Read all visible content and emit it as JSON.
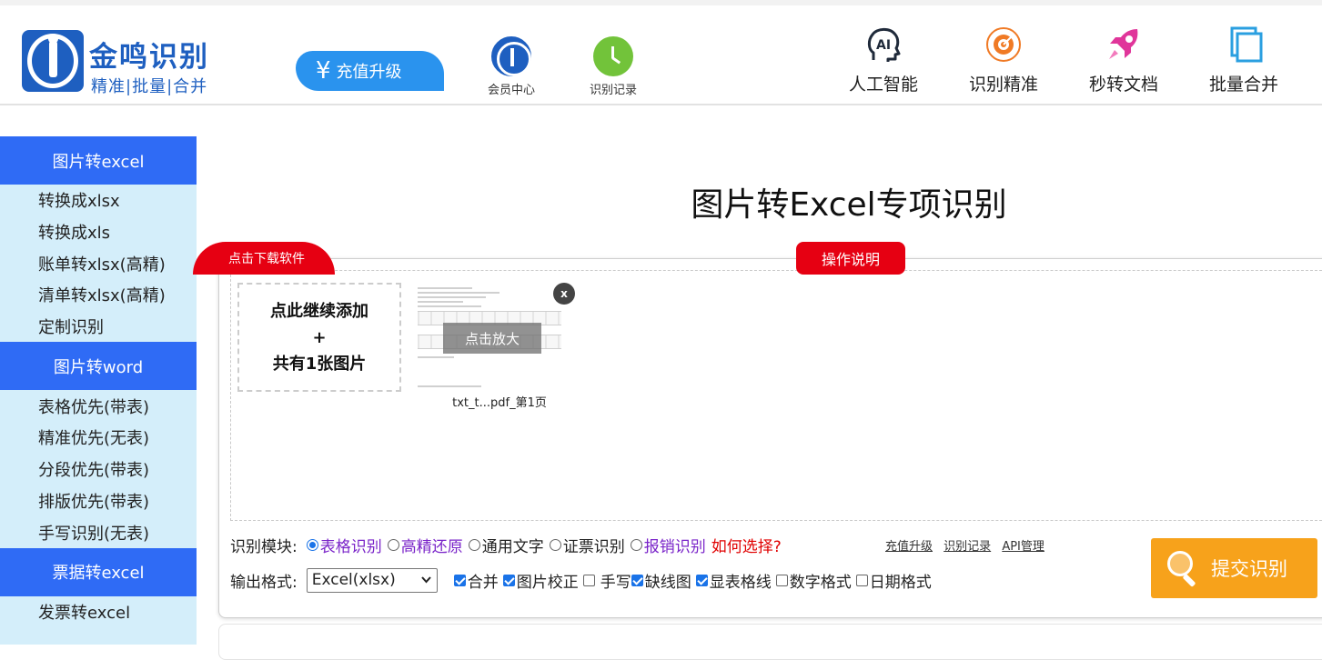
{
  "header": {
    "logo_name": "金鸣识别",
    "logo_tagline": "精准|批量|合并",
    "recharge_label": "充值升级",
    "recharge_symbol": "¥",
    "member_label": "会员中心",
    "record_label": "识别记录",
    "features": [
      "人工智能",
      "识别精准",
      "秒转文档",
      "批量合并"
    ],
    "ai_icon_text": "AI"
  },
  "sidebar": {
    "groups": [
      {
        "title": "图片转excel",
        "items": [
          "转换成xlsx",
          "转换成xls",
          "账单转xlsx(高精)",
          "清单转xlsx(高精)",
          "定制识别"
        ]
      },
      {
        "title": "图片转word",
        "items": [
          "表格优先(带表)",
          "精准优先(无表)",
          "分段优先(带表)",
          "排版优先(带表)",
          "手写识别(无表)"
        ]
      },
      {
        "title": "票据转excel",
        "items": [
          "发票转excel"
        ]
      }
    ]
  },
  "main": {
    "title": "图片转Excel专项识别",
    "download_tab": "点击下载软件",
    "help_tab": "操作说明",
    "add_box": {
      "line1": "点此继续添加",
      "line2": "+",
      "line3": "共有1张图片"
    },
    "thumbnail": {
      "zoom_label": "点击放大",
      "close_label": "x",
      "filename": "txt_t...pdf_第1页"
    },
    "module": {
      "label": "识别模块:",
      "options": [
        "表格识别",
        "高精还原",
        "通用文字",
        "证票识别",
        "报销识别"
      ],
      "selected": "表格识别",
      "how_choose": "如何选择?"
    },
    "links": [
      "充值升级",
      "识别记录",
      "API管理"
    ],
    "output": {
      "label": "输出格式:",
      "format_value": "Excel(xlsx)",
      "checks": [
        {
          "label": "合并",
          "checked": true
        },
        {
          "label": "图片校正",
          "checked": true
        },
        {
          "label": "手写",
          "checked": false
        },
        {
          "label": "缺线图",
          "checked": true
        },
        {
          "label": "显表格线",
          "checked": true
        },
        {
          "label": "数字格式",
          "checked": false
        },
        {
          "label": "日期格式",
          "checked": false
        }
      ]
    },
    "submit_label": "提交识别"
  },
  "colors": {
    "brand_blue": "#1e5fc0",
    "sidebar_head": "#2f6bf5",
    "sidebar_bg": "#d4eefa",
    "accent_red": "#e60012",
    "submit_orange": "#f7a21b",
    "recharge_blue": "#2a93ee"
  },
  "icons": {
    "member": "member-logo-icon",
    "record": "clock-icon",
    "features": [
      "ai-head-icon",
      "target-icon",
      "rocket-icon",
      "layers-icon"
    ],
    "submit": "magnifier-icon"
  }
}
